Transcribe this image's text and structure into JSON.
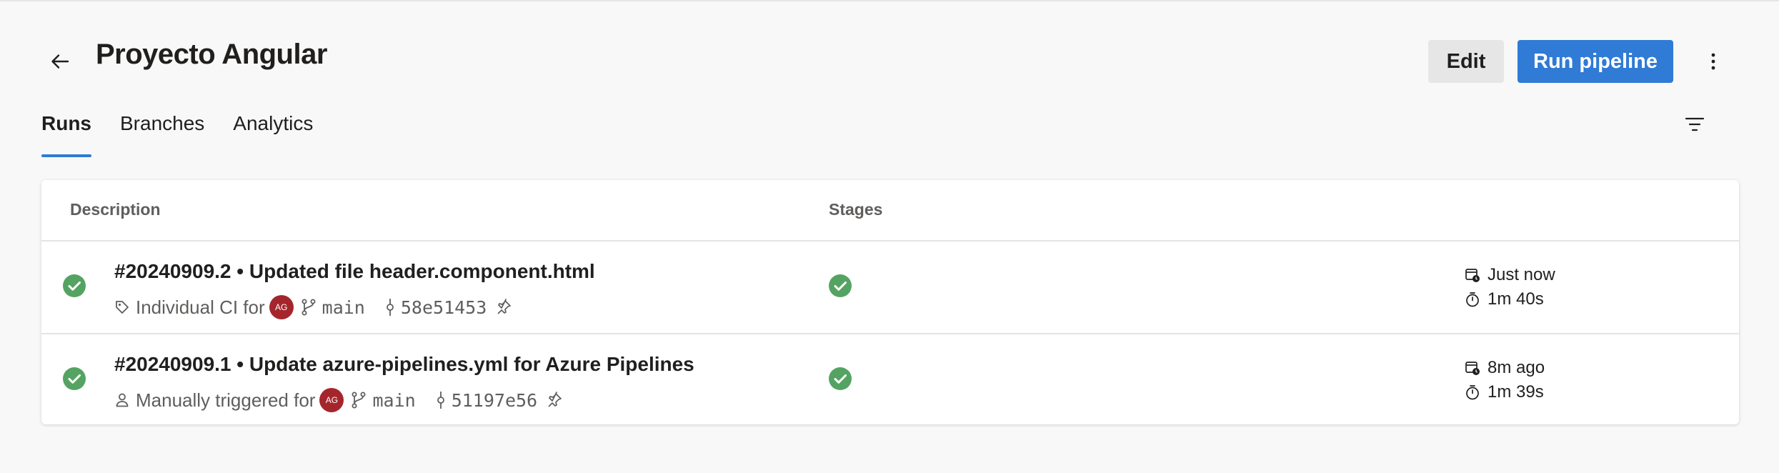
{
  "header": {
    "title": "Proyecto Angular",
    "edit_label": "Edit",
    "run_label": "Run pipeline"
  },
  "tabs": [
    {
      "label": "Runs",
      "active": true
    },
    {
      "label": "Branches",
      "active": false
    },
    {
      "label": "Analytics",
      "active": false
    }
  ],
  "table": {
    "columns": {
      "description": "Description",
      "stages": "Stages"
    },
    "rows": [
      {
        "title": "#20240909.2 • Updated file header.component.html",
        "trigger": "Individual CI for",
        "trigger_icon": "tag-icon",
        "avatar": "AG",
        "branch": "main",
        "commit": "58e51453",
        "when": "Just now",
        "duration": "1m 40s",
        "status": "succeeded"
      },
      {
        "title": "#20240909.1 • Update azure-pipelines.yml for Azure Pipelines",
        "trigger": "Manually triggered for",
        "trigger_icon": "person-icon",
        "avatar": "AG",
        "branch": "main",
        "commit": "51197e56",
        "when": "8m ago",
        "duration": "1m 39s",
        "status": "succeeded"
      }
    ]
  },
  "colors": {
    "accent": "#2f7bd5",
    "success": "#55a362",
    "avatar": "#a4262c",
    "background": "#f8f8f8"
  }
}
